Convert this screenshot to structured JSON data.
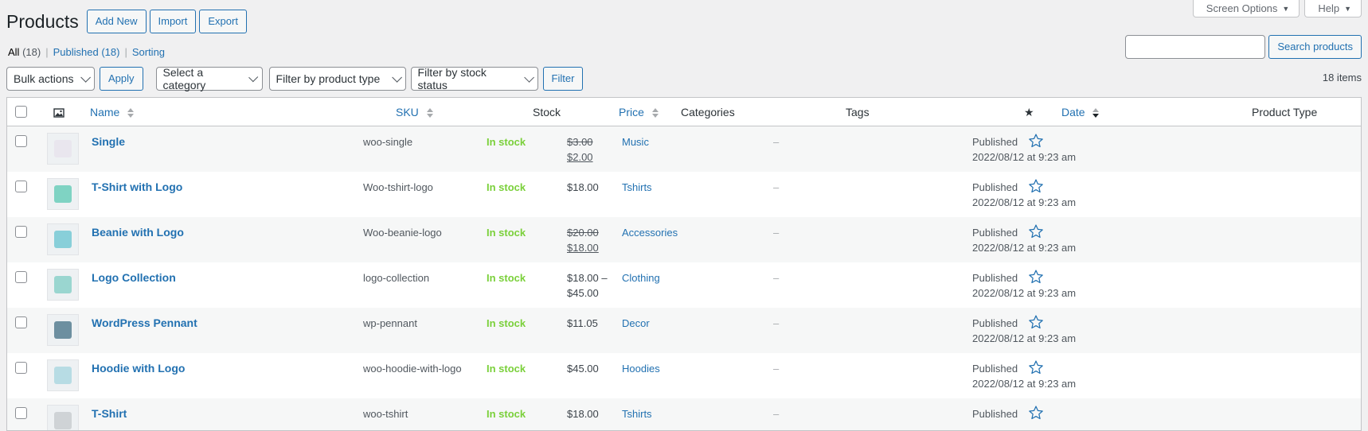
{
  "header": {
    "title": "Products",
    "actions": [
      "Add New",
      "Import",
      "Export"
    ]
  },
  "screen_meta": {
    "screen_options": "Screen Options",
    "help": "Help"
  },
  "views": [
    {
      "label": "All",
      "count": "(18)"
    },
    {
      "label": "Published",
      "count": "(18)"
    },
    {
      "label": "Sorting",
      "count": ""
    }
  ],
  "search": {
    "button": "Search products",
    "value": ""
  },
  "tablenav": {
    "bulk_actions": "Bulk actions",
    "apply": "Apply",
    "category": "Select a category",
    "product_type": "Filter by product type",
    "stock_status": "Filter by stock status",
    "filter": "Filter",
    "items_count": "18 items"
  },
  "columns": {
    "name": "Name",
    "sku": "SKU",
    "stock": "Stock",
    "price": "Price",
    "categories": "Categories",
    "tags": "Tags",
    "date": "Date",
    "product_type": "Product Type"
  },
  "rows": [
    {
      "name": "Single",
      "sku": "woo-single",
      "stock": "In stock",
      "price_old": "$3.00",
      "price_new": "$2.00",
      "price": "",
      "category": "Music",
      "tags": "–",
      "status": "Published",
      "date": "2022/08/12 at 9:23 am",
      "thumb_color": "#e9e6ee"
    },
    {
      "name": "T-Shirt with Logo",
      "sku": "Woo-tshirt-logo",
      "stock": "In stock",
      "price_old": "",
      "price_new": "",
      "price": "$18.00",
      "category": "Tshirts",
      "tags": "–",
      "status": "Published",
      "date": "2022/08/12 at 9:23 am",
      "thumb_color": "#7fd3c3"
    },
    {
      "name": "Beanie with Logo",
      "sku": "Woo-beanie-logo",
      "stock": "In stock",
      "price_old": "$20.00",
      "price_new": "$18.00",
      "price": "",
      "category": "Accessories",
      "tags": "–",
      "status": "Published",
      "date": "2022/08/12 at 9:23 am",
      "thumb_color": "#88cfd9"
    },
    {
      "name": "Logo Collection",
      "sku": "logo-collection",
      "stock": "In stock",
      "price_old": "",
      "price_new": "",
      "price": "$18.00 –\n$45.00",
      "category": "Clothing",
      "tags": "–",
      "status": "Published",
      "date": "2022/08/12 at 9:23 am",
      "thumb_color": "#9ad6d0"
    },
    {
      "name": "WordPress Pennant",
      "sku": "wp-pennant",
      "stock": "In stock",
      "price_old": "",
      "price_new": "",
      "price": "$11.05",
      "category": "Decor",
      "tags": "–",
      "status": "Published",
      "date": "2022/08/12 at 9:23 am",
      "thumb_color": "#6d8fa0"
    },
    {
      "name": "Hoodie with Logo",
      "sku": "woo-hoodie-with-logo",
      "stock": "In stock",
      "price_old": "",
      "price_new": "",
      "price": "$45.00",
      "category": "Hoodies",
      "tags": "–",
      "status": "Published",
      "date": "2022/08/12 at 9:23 am",
      "thumb_color": "#b7dce4"
    },
    {
      "name": "T-Shirt",
      "sku": "woo-tshirt",
      "stock": "In stock",
      "price_old": "",
      "price_new": "",
      "price": "$18.00",
      "category": "Tshirts",
      "tags": "–",
      "status": "Published",
      "date": "",
      "thumb_color": "#cfd3d6"
    }
  ],
  "colors": {
    "link": "#2271b1",
    "in_stock": "#7ad03a",
    "background": "#f0f0f1"
  }
}
